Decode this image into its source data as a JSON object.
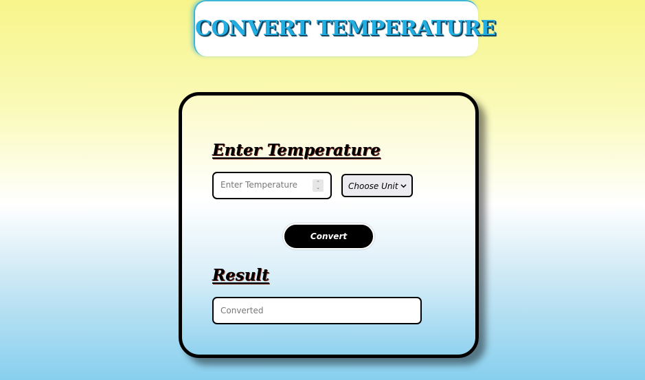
{
  "header": {
    "title": "CONVERT TEMPERATURE"
  },
  "form": {
    "enter_heading": "Enter Temperature",
    "temperature_input": {
      "placeholder": "Enter Temperature",
      "value": ""
    },
    "unit_select": {
      "selected": "Choose Unit",
      "icon": "chevron-down-icon"
    },
    "convert_label": "Convert",
    "result_heading": "Result",
    "result_field": {
      "placeholder": "Converted",
      "value": ""
    }
  },
  "colors": {
    "title": "#22aee0",
    "button_bg": "#000000",
    "border": "#000000"
  }
}
